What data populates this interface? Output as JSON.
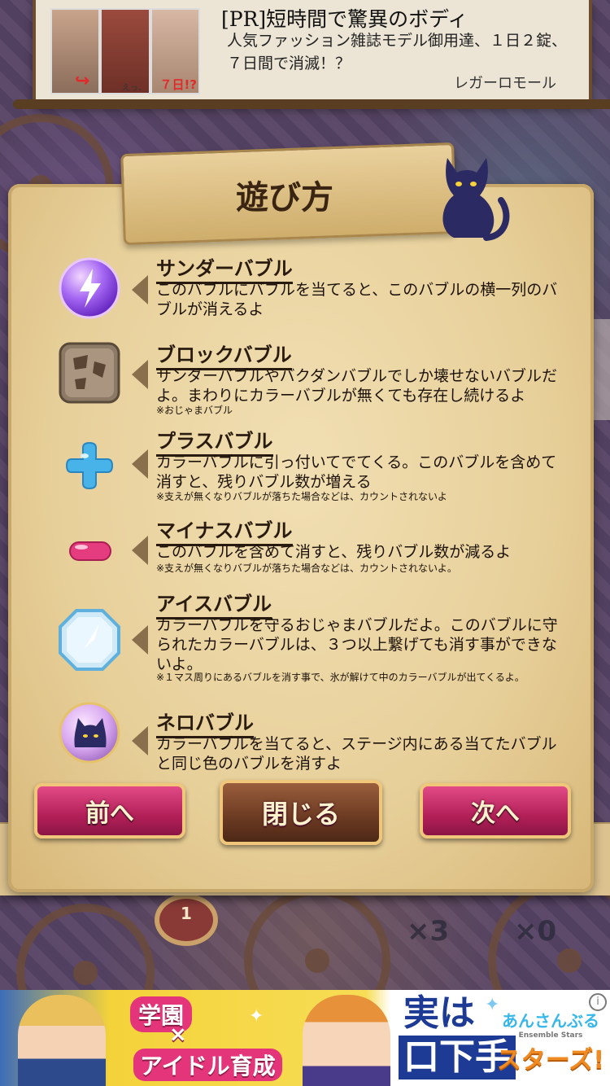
{
  "top_ad": {
    "title": "[PR]短時間で驚異のボディ",
    "body": "人気ファッション雑誌モデル御用達、１日２錠、７日間で消滅！？",
    "sponsor": "レガーロモール",
    "thumb_caption_eh": "えっ、",
    "thumb_caption_days": "７日!?"
  },
  "dialog": {
    "title": "遊び方",
    "sections": [
      {
        "name": "サンダーバブル",
        "desc": "このバブルにバブルを当てると、このバブルの横一列のバブルが消えるよ",
        "note": ""
      },
      {
        "name": "ブロックバブル",
        "desc": "サンダーバブルやバクダンバブルでしか壊せないバブルだよ。まわりにカラーバブルが無くても存在し続けるよ",
        "note": "※おじゃまバブル"
      },
      {
        "name": "プラスバブル",
        "desc": "カラーバブルに引っ付いてでてくる。このバブルを含めて消すと、残りバブル数が増える",
        "note": "※支えが無くなりバブルが落ちた場合などは、カウントされないよ"
      },
      {
        "name": "マイナスバブル",
        "desc": "このバブルを含めて消すと、残りバブル数が減るよ",
        "note": "※支えが無くなりバブルが落ちた場合などは、カウントされないよ。"
      },
      {
        "name": "アイスバブル",
        "desc": "カラーバブルを守るおじゃまバブルだよ。このバブルに守られたカラーバブルは、３つ以上繋げても消す事ができないよ。",
        "note": "※１マス周りにあるバブルを消す事で、氷が解けて中のカラーバブルが出てくるよ。"
      },
      {
        "name": "ネロバブル",
        "desc": "カラーバブルを当てると、ステージ内にある当てたバブルと同じ色のバブルを消すよ",
        "note": ""
      }
    ],
    "buttons": {
      "prev": "前へ",
      "close": "閉じる",
      "next": "次へ"
    }
  },
  "game_bg": {
    "counter": "1",
    "multiplier_1": "×3",
    "multiplier_2": "×0"
  },
  "bottom_ad": {
    "badge_1": "学園",
    "x_mark": "×",
    "badge_2": "アイドル育成",
    "headline_1": "実は",
    "headline_2": "口下手",
    "logo_top": "あんさんぶる",
    "logo_sub": "Ensemble Stars",
    "logo_bottom": "スターズ!",
    "info": "i"
  },
  "colors": {
    "parchment": "#e9d39f",
    "pink_button": "#c22a63",
    "brown_button": "#6b3a22",
    "gold_border": "#f0c77a"
  }
}
